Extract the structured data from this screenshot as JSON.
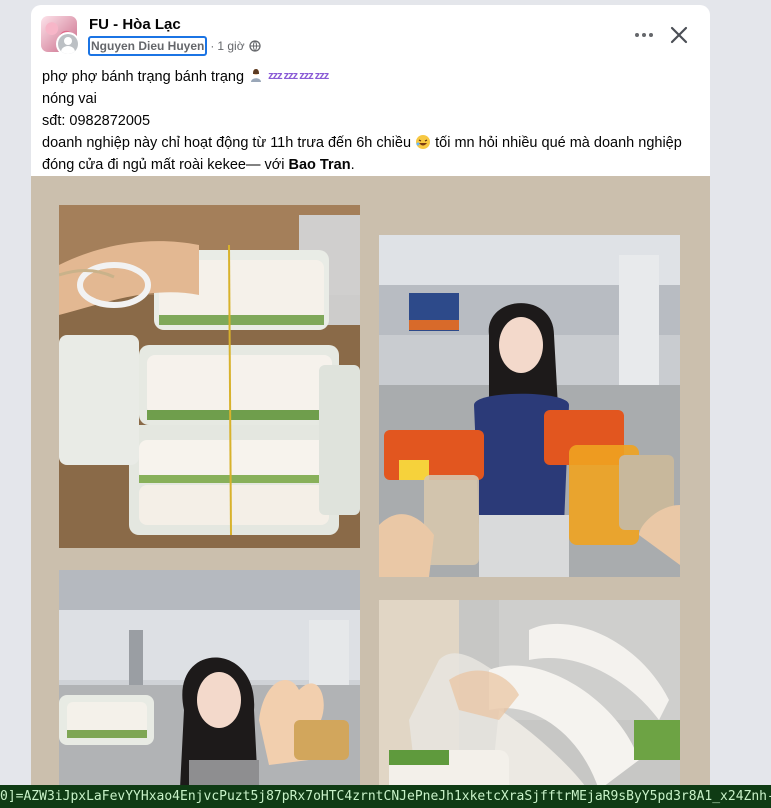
{
  "post": {
    "group_name": "FU - Hòa Lạc",
    "author": "Nguyen Dieu Huyen",
    "separator": "·",
    "time": "1 giờ",
    "icons": {
      "group_avatar": "group-avatar",
      "audience": "globe-icon",
      "more": "more-horizontal-icon",
      "close": "close-icon"
    },
    "text": {
      "line1": "phợ phợ bánh trạng bánh trạng",
      "line1_zzz": "zzz zzz zzz zzz",
      "line2": "nóng vai",
      "line3": "sđt: 0982872005",
      "line4_a": "doanh nghiệp này chỉ hoạt động từ 11h trưa đến 6h chiều",
      "line4_b": " tối mn hỏi nhiều qué mà doanh nghiệp đóng cửa đi ngủ mất roài kekee— với ",
      "mention": "Bao Tran",
      "end": "."
    },
    "photos": [
      {
        "name": "rice paper rolls in plastic boxes"
      },
      {
        "name": "girl holding snack bags in hall"
      },
      {
        "name": "girl holding roll box with hand sign"
      },
      {
        "name": "hand holding rice paper rolls"
      }
    ]
  },
  "browser": {
    "status_url": "0]=AZW3iJpxLaFevYYHxao4EnjvcPuzt5j87pRx7oHTC4zrntCNJePneJh1xketcXraSjfftrMEjaR9sByY5pd3r8A1_x24Znh-A7"
  }
}
